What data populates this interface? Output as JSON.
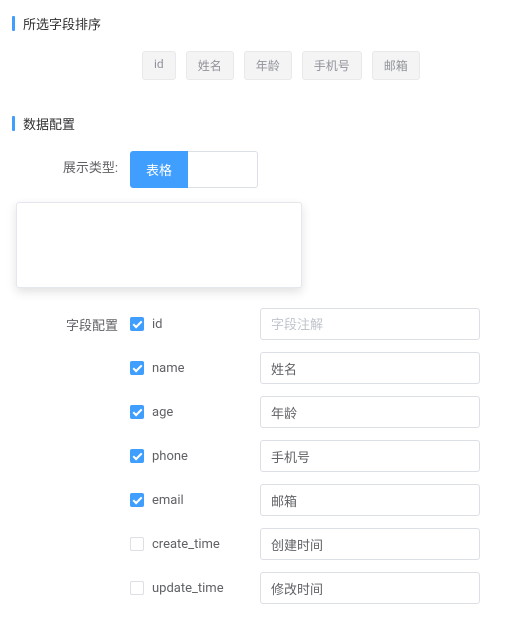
{
  "sections": {
    "sort_title": "所选字段排序",
    "data_config_title": "数据配置"
  },
  "tags": [
    "id",
    "姓名",
    "年龄",
    "手机号",
    "邮箱"
  ],
  "display_type": {
    "label": "展示类型:",
    "options": [
      "表格",
      ""
    ],
    "selected": "表格"
  },
  "field_config": {
    "label": "字段配置",
    "placeholder": "字段注解",
    "fields": [
      {
        "name": "id",
        "checked": true,
        "value": ""
      },
      {
        "name": "name",
        "checked": true,
        "value": "姓名"
      },
      {
        "name": "age",
        "checked": true,
        "value": "年龄"
      },
      {
        "name": "phone",
        "checked": true,
        "value": "手机号"
      },
      {
        "name": "email",
        "checked": true,
        "value": "邮箱"
      },
      {
        "name": "create_time",
        "checked": false,
        "value": "创建时间"
      },
      {
        "name": "update_time",
        "checked": false,
        "value": "修改时间"
      }
    ]
  }
}
